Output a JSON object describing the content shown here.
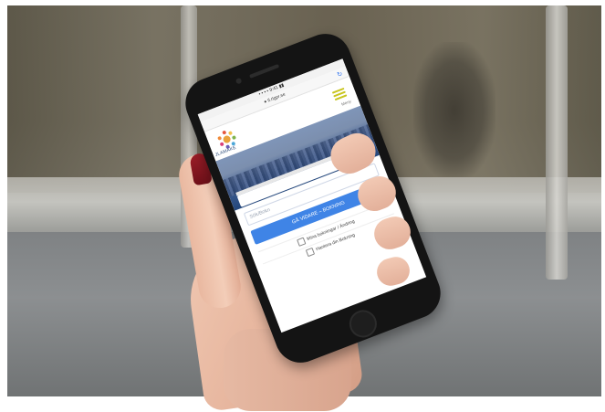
{
  "phone": {
    "status": "• • • •  9:41  ▮▮",
    "url": "● tl.rlgpr.se",
    "app_name": "JLAMAKE",
    "menu_label": "Meny",
    "search_placeholder": "Sök/Bokn",
    "primary_button": "GÅ VIDARE – BOKNING",
    "links": [
      "Mina bokningar / Ändring",
      "Hantera din Bokning"
    ]
  },
  "colors": {
    "accent": "#3f84e6",
    "menu": "#c8c51e",
    "nail": "#9e1e28"
  }
}
